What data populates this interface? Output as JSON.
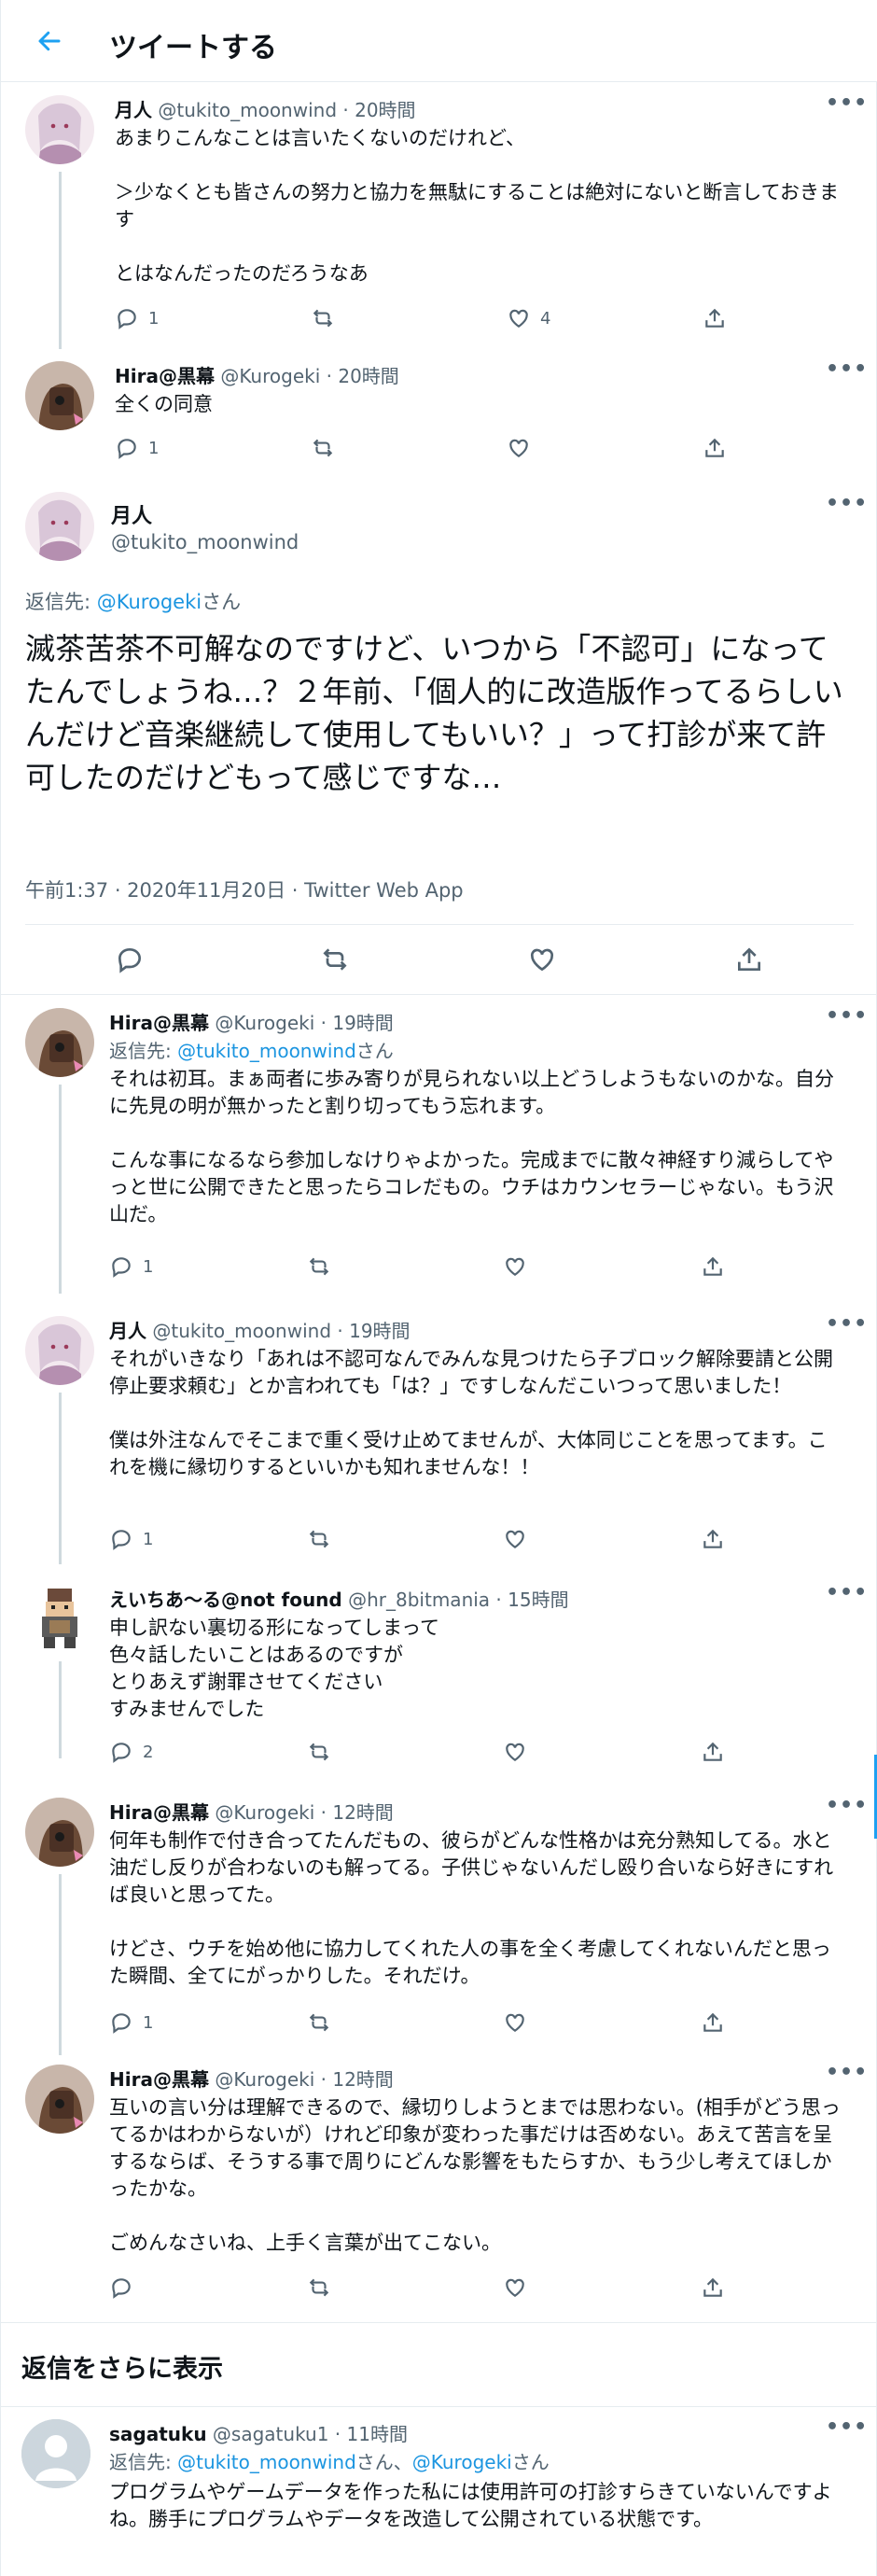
{
  "header": {
    "title": "ツイートする"
  },
  "colors": {
    "accent": "#1da1f2",
    "link": "#1b95e0",
    "muted": "#536471"
  },
  "tweets": [
    {
      "name": "月人",
      "handle": "@tukito_moonwind",
      "time": "20時間",
      "body": "あまりこんなことは言いたくないのだけれど、\n\n＞少なくとも皆さんの努力と協力を無駄にすることは絶対にないと断言しておきます\n\nとはなんだったのだろうなあ",
      "reply_count": "1",
      "like_count": "4"
    },
    {
      "name": "Hira@黒幕",
      "handle": "@Kurogeki",
      "time": "20時間",
      "body": "全くの同意",
      "reply_count": "1"
    }
  ],
  "focus": {
    "name": "月人",
    "handle": "@tukito_moonwind",
    "reply_label": "返信先: ",
    "reply_link": "@Kurogeki",
    "reply_suffix": "さん",
    "body": "滅茶苦茶不可解なのですけど、いつから「不認可」になってたんでしょうね…？２年前、「個人的に改造版作ってるらしいんだけど音楽継続して使用してもいい？」って打診が来て許可したのだけどもって感じですな…",
    "timestamp": "午前1:37 · 2020年11月20日 · Twitter Web App"
  },
  "replies": [
    {
      "name": "Hira@黒幕",
      "handle": "@Kurogeki",
      "time": "19時間",
      "reply_label": "返信先: ",
      "reply_link": "@tukito_moonwind",
      "reply_suffix": "さん",
      "body": "それは初耳。まぁ両者に歩み寄りが見られない以上どうしようもないのかな。自分に先見の明が無かったと割り切ってもう忘れます。\n\nこんな事になるなら参加しなけりゃよかった。完成までに散々神経すり減らしてやっと世に公開できたと思ったらコレだもの。ウチはカウンセラーじゃない。もう沢山だ。",
      "reply_count": "1"
    },
    {
      "name": "月人",
      "handle": "@tukito_moonwind",
      "time": "19時間",
      "body": "それがいきなり「あれは不認可なんでみんな見つけたら子ブロック解除要請と公開停止要求頼む」とか言われても「は？」ですしなんだこいつって思いました！\n\n僕は外注なんでそこまで重く受け止めてませんが、大体同じことを思ってます。これを機に縁切りするといいかも知れませんな！！",
      "reply_count": "1"
    },
    {
      "name": "えいちあ～る@not found",
      "handle": "@hr_8bitmania",
      "time": "15時間",
      "body": "申し訳ない裏切る形になってしまって\n色々話したいことはあるのですが\nとりあえず謝罪させてください\nすみませんでした",
      "reply_count": "2"
    },
    {
      "name": "Hira@黒幕",
      "handle": "@Kurogeki",
      "time": "12時間",
      "body": "何年も制作で付き合ってたんだもの、彼らがどんな性格かは充分熟知してる。水と油だし反りが合わないのも解ってる。子供じゃないんだし殴り合いなら好きにすれば良いと思ってた。\n\nけどさ、ウチを始め他に協力してくれた人の事を全く考慮してくれないんだと思った瞬間、全てにがっかりした。それだけ。",
      "reply_count": "1"
    },
    {
      "name": "Hira@黒幕",
      "handle": "@Kurogeki",
      "time": "12時間",
      "body": "互いの言い分は理解できるので、縁切りしようとまでは思わない。(相手がどう思ってるかはわからないが）けれど印象が変わった事だけは否めない。あえて苦言を呈するならば、そうする事で周りにどんな影響をもたらすか、もう少し考えてほしかったかな。\n\nごめんなさいね、上手く言葉が出てこない。",
      "reply_count": ""
    }
  ],
  "show_more": "返信をさらに表示",
  "last": {
    "name": "sagatuku",
    "handle": "@sagatuku1",
    "time": "11時間",
    "reply_label": "返信先: ",
    "reply_link1": "@tukito_moonwind",
    "reply_mid": "さん、",
    "reply_link2": "@Kurogeki",
    "reply_suffix": "さん",
    "body": "プログラムやゲームデータを作った私には使用許可の打診すらきていないんですよね。勝手にプログラムやデータを改造して公開されている状態です。"
  },
  "separator": " · ",
  "more_glyph": "•••"
}
